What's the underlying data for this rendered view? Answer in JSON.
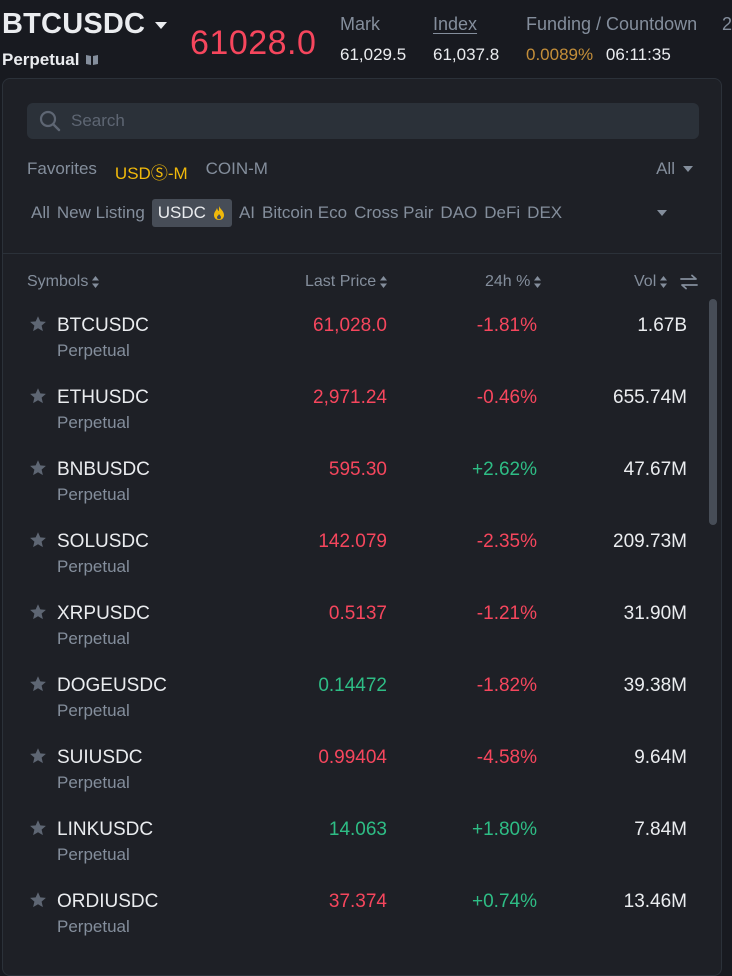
{
  "header": {
    "symbol": "BTCUSDC",
    "contract_type": "Perpetual",
    "last_price": "61028.0",
    "mark_label": "Mark",
    "mark_value": "61,029.5",
    "index_label": "Index",
    "index_value": "61,037.8",
    "funding_label": "Funding / Countdown",
    "funding_rate": "0.0089%",
    "countdown": "06:11:35",
    "edge_label_fragment": "2"
  },
  "search": {
    "placeholder": "Search"
  },
  "category_tabs": [
    {
      "label": "Favorites",
      "active": false
    },
    {
      "label": "USDⓈ-M",
      "active": true
    },
    {
      "label": "COIN-M",
      "active": false
    }
  ],
  "all_dropdown": {
    "label": "All"
  },
  "filters": [
    {
      "label": "All",
      "selected": false
    },
    {
      "label": "New Listing",
      "selected": false
    },
    {
      "label": "USDC",
      "selected": true
    },
    {
      "label": "AI",
      "selected": false
    },
    {
      "label": "Bitcoin Eco",
      "selected": false
    },
    {
      "label": "Cross Pair",
      "selected": false
    },
    {
      "label": "DAO",
      "selected": false
    },
    {
      "label": "DeFi",
      "selected": false
    },
    {
      "label": "DEX",
      "selected": false
    }
  ],
  "columns": {
    "symbols": "Symbols",
    "last_price": "Last Price",
    "change_24h": "24h %",
    "volume": "Vol"
  },
  "rows": [
    {
      "symbol": "BTCUSDC",
      "type": "Perpetual",
      "price": "61,028.0",
      "price_dir": "down",
      "change": "-1.81%",
      "change_dir": "down",
      "volume": "1.67B"
    },
    {
      "symbol": "ETHUSDC",
      "type": "Perpetual",
      "price": "2,971.24",
      "price_dir": "down",
      "change": "-0.46%",
      "change_dir": "down",
      "volume": "655.74M"
    },
    {
      "symbol": "BNBUSDC",
      "type": "Perpetual",
      "price": "595.30",
      "price_dir": "down",
      "change": "+2.62%",
      "change_dir": "up",
      "volume": "47.67M"
    },
    {
      "symbol": "SOLUSDC",
      "type": "Perpetual",
      "price": "142.079",
      "price_dir": "down",
      "change": "-2.35%",
      "change_dir": "down",
      "volume": "209.73M"
    },
    {
      "symbol": "XRPUSDC",
      "type": "Perpetual",
      "price": "0.5137",
      "price_dir": "down",
      "change": "-1.21%",
      "change_dir": "down",
      "volume": "31.90M"
    },
    {
      "symbol": "DOGEUSDC",
      "type": "Perpetual",
      "price": "0.14472",
      "price_dir": "up",
      "change": "-1.82%",
      "change_dir": "down",
      "volume": "39.38M"
    },
    {
      "symbol": "SUIUSDC",
      "type": "Perpetual",
      "price": "0.99404",
      "price_dir": "down",
      "change": "-4.58%",
      "change_dir": "down",
      "volume": "9.64M"
    },
    {
      "symbol": "LINKUSDC",
      "type": "Perpetual",
      "price": "14.063",
      "price_dir": "up",
      "change": "+1.80%",
      "change_dir": "up",
      "volume": "7.84M"
    },
    {
      "symbol": "ORDIUSDC",
      "type": "Perpetual",
      "price": "37.374",
      "price_dir": "down",
      "change": "+0.74%",
      "change_dir": "up",
      "volume": "13.46M"
    }
  ],
  "colors": {
    "up": "#2ebd85",
    "down": "#f6465d",
    "accent": "#f0b90b",
    "background": "#181a20",
    "panel": "#1e2026"
  }
}
